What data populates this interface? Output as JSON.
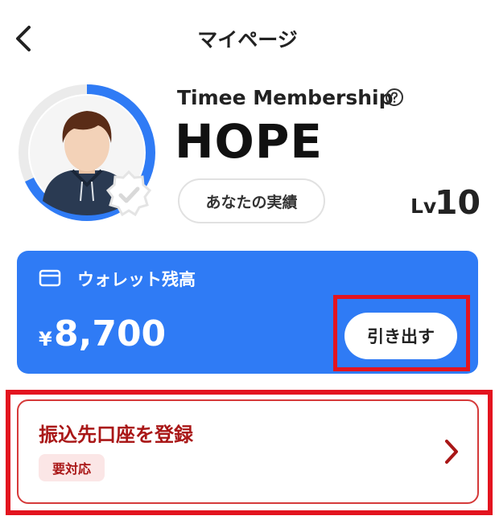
{
  "header": {
    "title": "マイページ"
  },
  "profile": {
    "membership_title": "Timee Membership",
    "rank": "HOPE",
    "achievements_label": "あなたの実績",
    "level_label": "Lv",
    "level_value": "10",
    "progress_fraction": 0.68
  },
  "wallet": {
    "title": "ウォレット残高",
    "currency": "¥",
    "amount": "8,700",
    "withdraw_label": "引き出す"
  },
  "bank": {
    "title": "振込先口座を登録",
    "badge": "要対応"
  },
  "colors": {
    "accent": "#2f7bf5",
    "warning_text": "#a91717",
    "highlight": "#e3141f"
  }
}
